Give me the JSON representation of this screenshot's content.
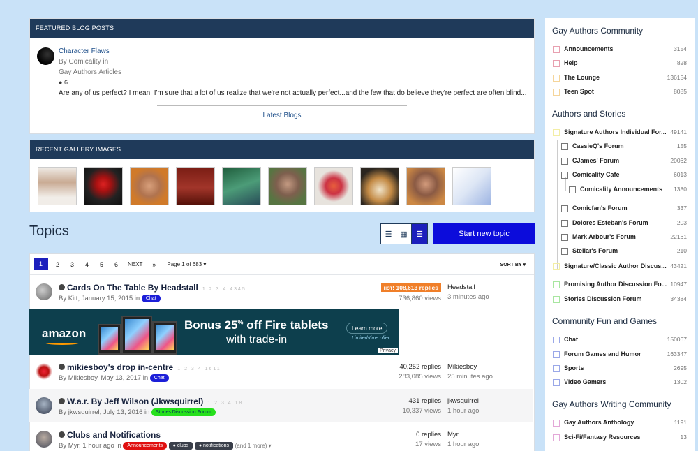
{
  "featured": {
    "header": "Featured Blog Posts",
    "title": "Character Flaws",
    "by": "By Comicality in",
    "category": "Gay Authors Articles",
    "comments": "6",
    "excerpt": "Are any of us perfect? I mean, I'm sure that a lot of us realize that we're not actually perfect...and the few that do believe they're perfect are often blind...",
    "latest_link": "Latest Blogs"
  },
  "gallery": {
    "header": "Recent Gallery Images"
  },
  "topics": {
    "heading": "Topics",
    "start_button": "Start new topic",
    "pager": {
      "pages": [
        "1",
        "2",
        "3",
        "4",
        "5",
        "6"
      ],
      "next": "NEXT",
      "last": "»",
      "page_of": "Page 1 of 683",
      "sort": "SORT BY"
    },
    "rows": [
      {
        "title": "Cards On The Table By Headstall",
        "pages": "1 2 3 4 4345",
        "by": "By Kitt, January 15, 2015 in",
        "tag": "Chat",
        "hot": "HOT",
        "replies": "108,613 replies",
        "views": "736,860 views",
        "last_user": "Headstall",
        "last_time": "3 minutes ago"
      },
      {
        "title": "mikiesboy's drop in-centre",
        "pages": "1 2 3 4 1611",
        "by": "By Mikiesboy, May 13, 2017 in",
        "tag": "Chat",
        "replies": "40,252 replies",
        "views": "283,085 views",
        "last_user": "Mikiesboy",
        "last_time": "25 minutes ago"
      },
      {
        "title": "W.a.r. By Jeff Wilson (Jkwsquirrel)",
        "pages": "1 2 3 4 18",
        "by": "By jkwsquirrel, July 13, 2016 in",
        "tag": "Stories Discussion Forum",
        "replies": "431 replies",
        "views": "10,337 views",
        "last_user": "jkwsquirrel",
        "last_time": "1 hour ago"
      },
      {
        "title": "Clubs and Notifications",
        "by": "By Myr, 1 hour ago in",
        "tag": "Announcements",
        "tag2": "clubs",
        "tag3": "notifications",
        "more": "(and 1 more)",
        "replies": "0 replies",
        "views": "17 views",
        "last_user": "Myr",
        "last_time": "1 hour ago"
      }
    ]
  },
  "ad": {
    "logo": "amazon",
    "headline_pre": "Bonus 25",
    "headline_sup": "%",
    "headline_post": " off Fire tablets",
    "subline": "with trade-in",
    "button": "Learn more",
    "limited": "Limited-time offer",
    "privacy": "Privacy"
  },
  "sidebar": {
    "sections": [
      {
        "title": "Gay Authors Community",
        "items": [
          {
            "label": "Announcements",
            "count": "3154",
            "color": "#e8a0b0"
          },
          {
            "label": "Help",
            "count": "828",
            "color": "#e8a0b0"
          },
          {
            "label": "The Lounge",
            "count": "136154",
            "color": "#f5d59a"
          },
          {
            "label": "Teen Spot",
            "count": "8085",
            "color": "#f5d59a"
          }
        ]
      },
      {
        "title": "Authors and Stories",
        "items": [
          {
            "label": "Signature Authors Individual For...",
            "count": "49141",
            "color": "#f3eea5"
          },
          {
            "label": "CassieQ's Forum",
            "count": "155",
            "color": "#777777"
          },
          {
            "label": "CJames' Forum",
            "count": "20062",
            "color": "#777777"
          },
          {
            "label": "Comicality Cafe",
            "count": "6013",
            "color": "#777777"
          },
          {
            "label": "Comicality Announcements",
            "count": "1380",
            "color": "#777777"
          },
          {
            "label": "Comicfan's Forum",
            "count": "337",
            "color": "#777777"
          },
          {
            "label": "Dolores Esteban's Forum",
            "count": "203",
            "color": "#777777"
          },
          {
            "label": "Mark Arbour's Forum",
            "count": "22161",
            "color": "#777777"
          },
          {
            "label": "Stellar's Forum",
            "count": "210",
            "color": "#777777"
          },
          {
            "label": "Signature/Classic Author Discus...",
            "count": "43421",
            "color": "#f3eea5"
          },
          {
            "label": "Promising Author Discussion Fo...",
            "count": "10947",
            "color": "#a8e6a0"
          },
          {
            "label": "Stories Discussion Forum",
            "count": "34384",
            "color": "#a8e6a0"
          }
        ]
      },
      {
        "title": "Community Fun and Games",
        "items": [
          {
            "label": "Chat",
            "count": "150067",
            "color": "#9aa8e8"
          },
          {
            "label": "Forum Games and Humor",
            "count": "163347",
            "color": "#9aa8e8"
          },
          {
            "label": "Sports",
            "count": "2695",
            "color": "#9aa8e8"
          },
          {
            "label": "Video Gamers",
            "count": "1302",
            "color": "#9aa8e8"
          }
        ]
      },
      {
        "title": "Gay Authors Writing Community",
        "items": [
          {
            "label": "Gay Authors Anthology",
            "count": "1191",
            "color": "#e3a8d8"
          },
          {
            "label": "Sci-Fi/Fantasy Resources",
            "count": "13",
            "color": "#e3a8d8"
          }
        ]
      }
    ]
  }
}
